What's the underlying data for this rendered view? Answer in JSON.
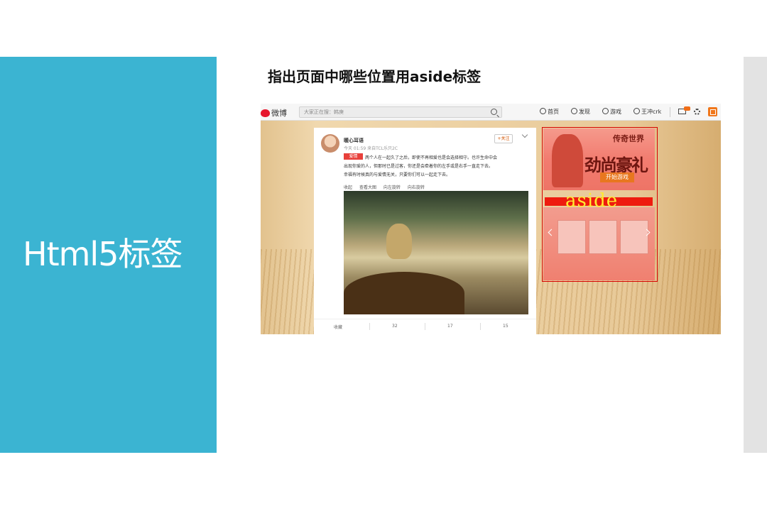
{
  "slide": {
    "title": "Html5标签",
    "heading": "指出页面中哪些位置用aside标签"
  },
  "weibo": {
    "logo_text": "微博",
    "search_placeholder": "大家正在搜：韩庚",
    "nav": {
      "home": "首页",
      "discover": "发现",
      "game": "游戏",
      "user": "王冲crk"
    },
    "post": {
      "author": "暖心耳语",
      "meta": "今天 01:59 来自TCL乐只2C",
      "follow_label": "+关注",
      "tag": "爱情",
      "text_lines": [
        "两个人在一起久了之后，即使不再相爱也是会选择相守。也许生命中会",
        "出现你爱的人，但那时已是过客，你还是会牵着你的左手或是右手一直走下去。",
        "幸福有时候真的与爱情无关，只要你们可以一起走下去。"
      ],
      "actions": [
        "收起",
        "查看大图",
        "向左旋转",
        "向右旋转"
      ],
      "footer": {
        "favorite": "收藏",
        "repost": "32",
        "comment": "17",
        "like": "15"
      }
    },
    "aside": {
      "label": "aside",
      "ad1": {
        "brand": "传奇世界",
        "big_text": "劲尚豪礼",
        "button": "开始游戏"
      }
    }
  },
  "colors": {
    "panel": "#3bb4d2",
    "aside_border": "#d80000",
    "aside_label": "#ffea30"
  }
}
